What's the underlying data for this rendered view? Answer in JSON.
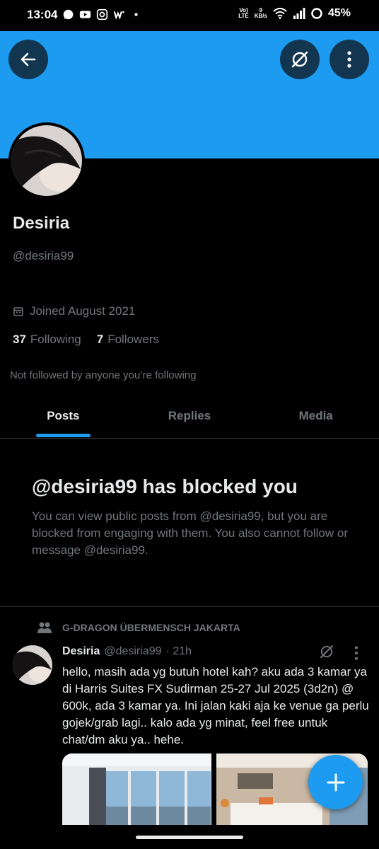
{
  "status_bar": {
    "time": "13:04",
    "network_top": "Vo)",
    "network_bottom": "LTE",
    "speed_top": "9",
    "speed_bottom": "KB/s",
    "battery": "45%",
    "icons": [
      "whatsapp-icon",
      "youtube-icon",
      "instagram-icon",
      "webtoon-icon",
      "dot-icon",
      "wifi-icon",
      "signal-icon",
      "battery-ring-icon"
    ]
  },
  "colors": {
    "accent": "#1d9bf0",
    "background": "#000000",
    "text_primary": "#e7e9ea",
    "text_secondary": "#71767b",
    "divider": "#2f3336"
  },
  "profile": {
    "name": "Desiria",
    "handle": "@desiria99",
    "joined": "Joined August 2021",
    "following_count": "37",
    "following_label": "Following",
    "followers_count": "7",
    "followers_label": "Followers",
    "not_followed": "Not followed by anyone you’re following"
  },
  "tabs": [
    {
      "label": "Posts",
      "active": true
    },
    {
      "label": "Replies",
      "active": false
    },
    {
      "label": "Media",
      "active": false
    }
  ],
  "blocked": {
    "title": "@desiria99 has blocked you",
    "description": "You can view public posts from @desiria99, but you are blocked from engaging with them. You also cannot follow or message @desiria99."
  },
  "post": {
    "community": "G-DRAGON ÜBERMENSCH JAKARTA",
    "author_name": "Desiria",
    "author_handle": "@desiria99",
    "time": "· 21h",
    "text": "hello, masih ada yg butuh hotel kah? aku ada 3 kamar ya di Harris Suites FX Sudirman 25-27 Jul 2025 (3d2n) @ 600k, ada 3 kamar ya. Ini jalan kaki aja ke venue ga perlu gojek/grab lagi.. kalo ada yg minat, feel free untuk chat/dm aku ya.. hehe."
  }
}
